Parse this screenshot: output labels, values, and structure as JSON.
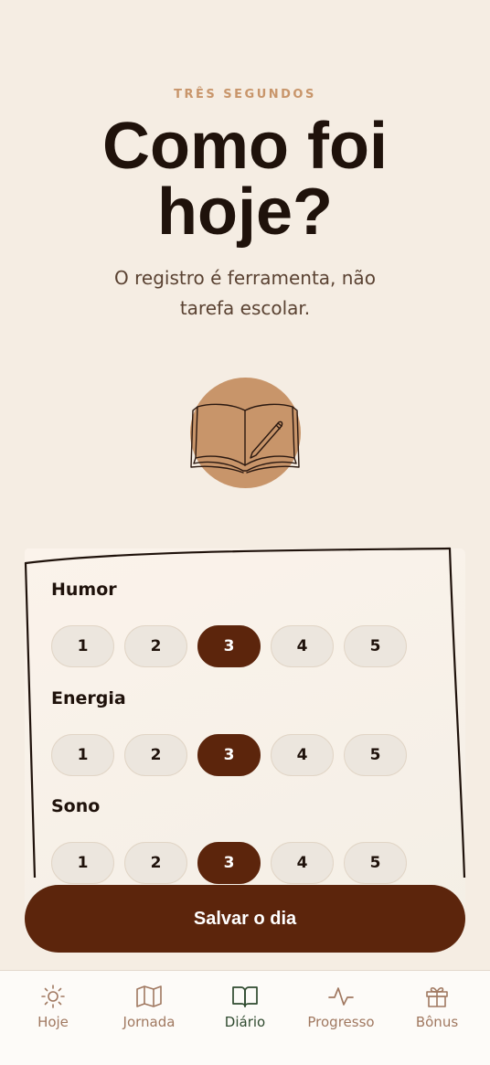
{
  "header": {
    "eyebrow": "TRÊS SEGUNDOS",
    "title_line1": "Como foi",
    "title_line2": "hoje?",
    "subtitle_line1": "O registro é ferramenta, não",
    "subtitle_line2": "tarefa escolar."
  },
  "illustration": {
    "icon": "open-book-with-pen-icon",
    "badge_color": "#c8956a"
  },
  "scales": [
    {
      "label": "Humor",
      "options": [
        "1",
        "2",
        "3",
        "4",
        "5"
      ],
      "selected": "3"
    },
    {
      "label": "Energia",
      "options": [
        "1",
        "2",
        "3",
        "4",
        "5"
      ],
      "selected": "3"
    },
    {
      "label": "Sono",
      "options": [
        "1",
        "2",
        "3",
        "4",
        "5"
      ],
      "selected": "3"
    }
  ],
  "save_button": {
    "label": "Salvar o dia"
  },
  "nav": {
    "items": [
      {
        "label": "Hoje",
        "icon": "sun-icon"
      },
      {
        "label": "Jornada",
        "icon": "map-icon"
      },
      {
        "label": "Diário",
        "icon": "book-icon",
        "active": true
      },
      {
        "label": "Progresso",
        "icon": "activity-icon"
      },
      {
        "label": "Bônus",
        "icon": "gift-icon"
      }
    ]
  },
  "colors": {
    "background": "#f5ede3",
    "primary": "#5c250c",
    "accent": "#c8956a",
    "active_nav": "#2f4a2f"
  }
}
